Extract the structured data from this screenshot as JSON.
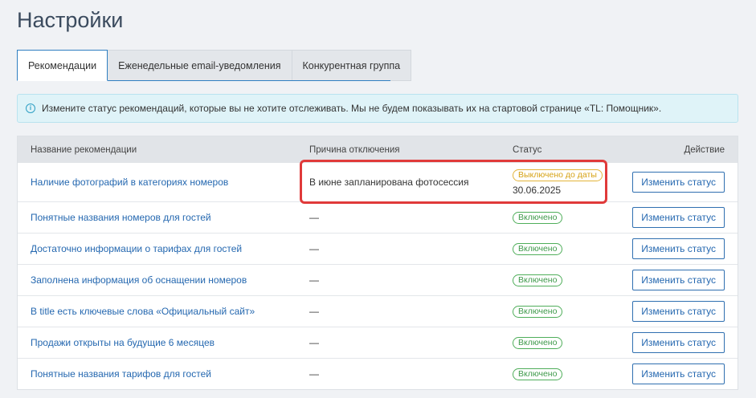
{
  "page": {
    "title": "Настройки"
  },
  "tabs": [
    {
      "label": "Рекомендации",
      "active": true
    },
    {
      "label": "Еженедельные email-уведомления",
      "active": false
    },
    {
      "label": "Конкурентная группа",
      "active": false
    }
  ],
  "info": {
    "icon": "info-icon",
    "text": "Измените статус рекомендаций, которые вы не хотите отслеживать. Мы не будем показывать их на стартовой странице «TL: Помощник»."
  },
  "table": {
    "columns": {
      "name": "Название рекомендации",
      "reason": "Причина отключения",
      "status": "Статус",
      "action": "Действие"
    },
    "action_label": "Изменить статус",
    "rows": [
      {
        "name": "Наличие фотографий в категориях номеров",
        "reason": "В июне запланирована фотосессия",
        "status": "Выключено до даты",
        "status_date": "30.06.2025",
        "status_type": "off"
      },
      {
        "name": "Понятные названия номеров для гостей",
        "reason": "—",
        "status": "Включено",
        "status_type": "on"
      },
      {
        "name": "Достаточно информации о тарифах для гостей",
        "reason": "—",
        "status": "Включено",
        "status_type": "on"
      },
      {
        "name": "Заполнена информация об оснащении номеров",
        "reason": "—",
        "status": "Включено",
        "status_type": "on"
      },
      {
        "name": "В title есть ключевые слова «Официальный сайт»",
        "reason": "—",
        "status": "Включено",
        "status_type": "on"
      },
      {
        "name": "Продажи открыты на будущие 6 месяцев",
        "reason": "—",
        "status": "Включено",
        "status_type": "on"
      },
      {
        "name": "Понятные названия тарифов для гостей",
        "reason": "—",
        "status": "Включено",
        "status_type": "on"
      }
    ]
  },
  "colors": {
    "accent": "#2f7fc1",
    "link": "#2568b0",
    "status_on": "#4fae5a",
    "status_off": "#e3b43a",
    "highlight": "#e03a3a"
  }
}
